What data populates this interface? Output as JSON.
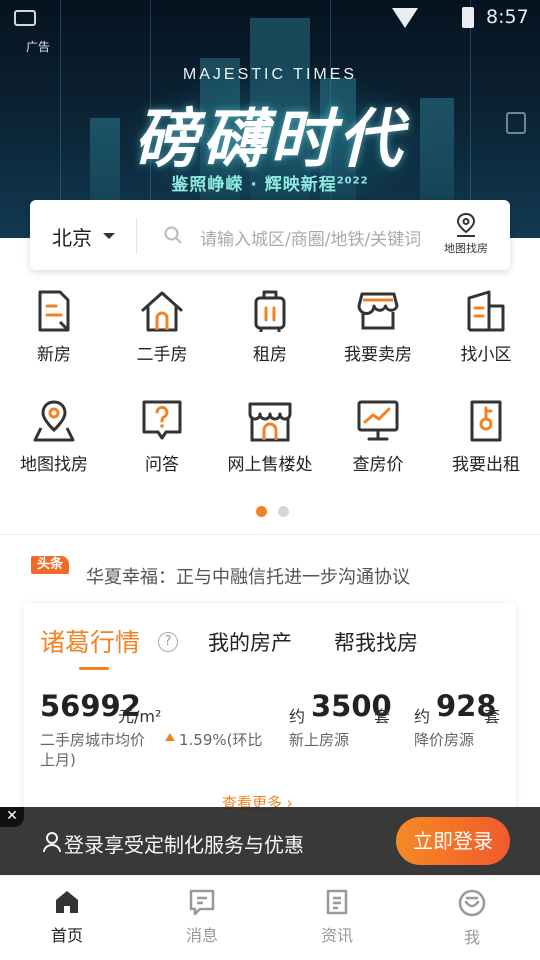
{
  "status_bar": {
    "time": "8:57"
  },
  "banner": {
    "ad_tag": "广告",
    "brand_en": "MAJESTIC TIMES",
    "title": "磅礴时代",
    "subtitle": "鉴照峥嵘 · 辉映新程",
    "subtitle_year": "2022"
  },
  "search": {
    "city": "北京",
    "placeholder": "请输入城区/商圈/地铁/关键词",
    "map_find_label": "地图找房"
  },
  "grid": {
    "items": [
      {
        "label": "新房",
        "icon": "new-house-icon"
      },
      {
        "label": "二手房",
        "icon": "second-hand-house-icon"
      },
      {
        "label": "租房",
        "icon": "rent-luggage-icon"
      },
      {
        "label": "我要卖房",
        "icon": "sell-shop-icon"
      },
      {
        "label": "找小区",
        "icon": "community-building-icon"
      },
      {
        "label": "地图找房",
        "icon": "map-pin-icon"
      },
      {
        "label": "问答",
        "icon": "question-icon"
      },
      {
        "label": "网上售楼处",
        "icon": "online-sales-office-icon"
      },
      {
        "label": "查房价",
        "icon": "price-chart-icon"
      },
      {
        "label": "我要出租",
        "icon": "key-lease-icon"
      }
    ]
  },
  "pager": {
    "pages": 2,
    "active": 1
  },
  "headline": {
    "tag": "头条",
    "text": "华夏幸福：正与中融信托进一步沟通协议"
  },
  "market": {
    "tabs": [
      "诸葛行情",
      "我的房产",
      "帮我找房"
    ],
    "active_tab": 0,
    "help_symbol": "?",
    "avg_price": {
      "value": "56992",
      "unit": "元/m²",
      "label": "二手房城市均价",
      "change": "1.59%(环比",
      "change_line2": "上月)"
    },
    "new_listings": {
      "prefix": "约",
      "value": "3500",
      "unit": "套",
      "label": "新上房源"
    },
    "price_drop": {
      "prefix": "约",
      "value": "928",
      "unit": "套",
      "label": "降价房源"
    },
    "see_more": "查看更多 ›"
  },
  "login_bar": {
    "close_symbol": "✕",
    "text": "登录享受定制化服务与优惠",
    "button": "立即登录"
  },
  "bottom_nav": {
    "items": [
      {
        "label": "首页",
        "icon": "home-icon",
        "active": true
      },
      {
        "label": "消息",
        "icon": "message-icon",
        "active": false
      },
      {
        "label": "资讯",
        "icon": "news-icon",
        "active": false
      },
      {
        "label": "我",
        "icon": "profile-icon",
        "active": false
      }
    ]
  },
  "colors": {
    "accent": "#f28324",
    "accent_red": "#f15a2b",
    "icon_dark": "#333333",
    "nav_inactive": "#999999"
  }
}
